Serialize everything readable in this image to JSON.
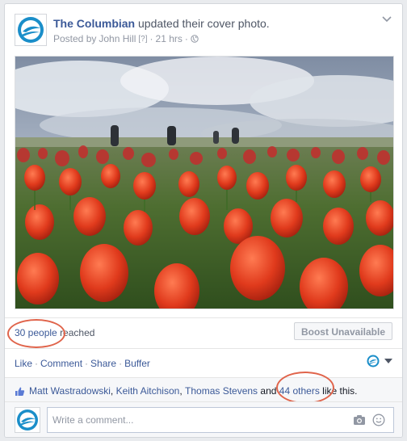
{
  "post": {
    "page_name": "The Columbian",
    "action_text": "updated their cover photo.",
    "posted_by_prefix": "Posted by",
    "author": "John Hill",
    "help_marker": "[?]",
    "dot": "·",
    "time": "21 hrs",
    "audience_icon": "globe-icon",
    "photo_alt": "Red tulip field under a cloudy sky with people in the distance"
  },
  "reach": {
    "count_text": "30 people",
    "suffix": "reached",
    "boost_label": "Boost Unavailable"
  },
  "actions": {
    "like": "Like",
    "comment": "Comment",
    "share": "Share",
    "buffer": "Buffer",
    "sep": "·"
  },
  "likes": {
    "names": [
      "Matt Wastradowski",
      "Keith Aitchison",
      "Thomas Stevens"
    ],
    "comma": ",",
    "and": "and",
    "others": "44 others",
    "suffix": "like this."
  },
  "comment": {
    "placeholder": "Write a comment..."
  },
  "colors": {
    "link": "#3b5998",
    "annotation_circle": "#e0644b",
    "brand_logo": "#1a8ec9"
  }
}
